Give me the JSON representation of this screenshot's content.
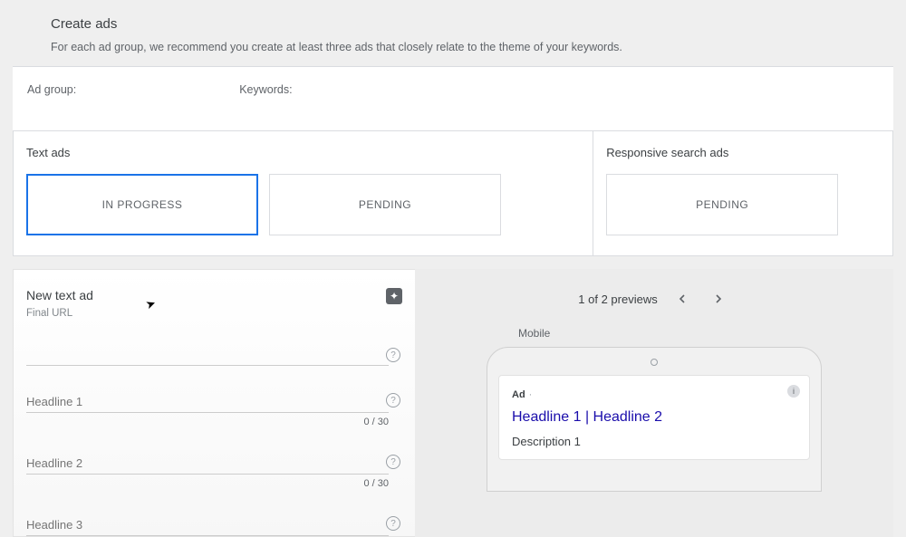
{
  "header": {
    "title": "Create ads",
    "subtitle": "For each ad group, we recommend you create at least three ads that closely relate to the theme of your keywords."
  },
  "groupbar": {
    "ad_group_label": "Ad group:",
    "keywords_label": "Keywords:"
  },
  "categories": {
    "text_ads_title": "Text ads",
    "responsive_title": "Responsive search ads",
    "in_progress": "IN PROGRESS",
    "pending": "PENDING"
  },
  "form": {
    "title": "New text ad",
    "final_url_label": "Final URL",
    "headline1_placeholder": "Headline 1",
    "headline2_placeholder": "Headline 2",
    "headline3_placeholder": "Headline 3",
    "counter": "0 / 30"
  },
  "preview": {
    "count_label": "1 of 2 previews",
    "mobile_label": "Mobile",
    "ad_tag": "Ad",
    "headline": "Headline 1 | Headline 2",
    "description": "Description 1"
  }
}
